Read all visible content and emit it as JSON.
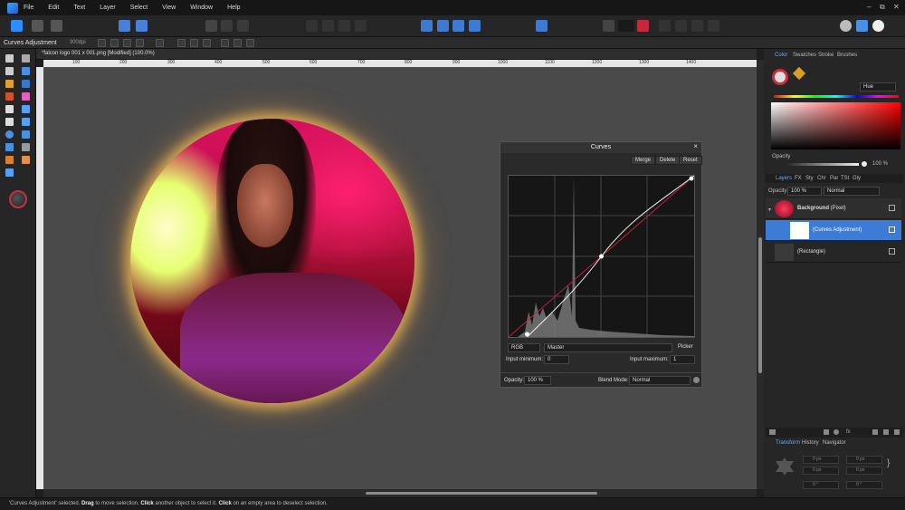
{
  "menu": [
    "File",
    "Edit",
    "Text",
    "Layer",
    "Select",
    "View",
    "Window",
    "Help"
  ],
  "window_controls": [
    "–",
    "⧉",
    "✕"
  ],
  "context": {
    "title": "Curves Adjustment",
    "dpi": "300dpi"
  },
  "document_tab": "*falcon logo 001 x 001.png [Modified] (100.0%)",
  "ruler_ticks": [
    "100",
    "200",
    "300",
    "400",
    "500",
    "600",
    "700",
    "800",
    "900",
    "1000",
    "1100",
    "1200",
    "1300",
    "1400"
  ],
  "curves": {
    "title": "Curves",
    "merge_label": "Merge",
    "delete_label": "Delete",
    "reset_label": "Reset",
    "channel_mode": "RGB",
    "channel": "Master",
    "picker_label": "Picker",
    "input_min_label": "Input minimum:",
    "input_min": "0",
    "input_max_label": "Input maximum:",
    "input_max": "1",
    "opacity_label": "Opacity:",
    "opacity": "100 %",
    "blend_label": "Blend Mode:",
    "blend": "Normal",
    "control_points": [
      [
        0.1,
        0.0
      ],
      [
        0.5,
        0.5
      ],
      [
        1.0,
        1.0
      ]
    ]
  },
  "right_panel": {
    "color_tabs": [
      "Color",
      "Swatches",
      "Stroke",
      "Brushes"
    ],
    "color_mode": "Hue",
    "opacity_label": "Opacity",
    "opacity_value": "100 %",
    "opacity_level": 1.0,
    "layer_tabs": [
      "Layers",
      "FX",
      "Sty",
      "Chr",
      "Par",
      "TSt",
      "Gly"
    ],
    "layers_opacity_label": "Opacity:",
    "layers_opacity": "100 %",
    "layers_blend": "Normal",
    "layers": [
      {
        "name": "Background",
        "suffix": " (Pixel)"
      },
      {
        "name": "(Curves Adjustment)",
        "suffix": ""
      },
      {
        "name": "(Rectangle)",
        "suffix": ""
      }
    ],
    "bottom_tabs": [
      "Transform",
      "History",
      "Navigator"
    ],
    "transform": {
      "x": "0 px",
      "y": "0 px",
      "w": "0 px",
      "h": "0 px",
      "r": "0 °",
      "s": "0 °"
    }
  },
  "status": {
    "prefix": "'Curves Adjustment' selected. ",
    "drag": "Drag",
    "drag_text": " to move selection. ",
    "click": "Click",
    "click_text": " another object to select it. ",
    "click2": "Click",
    "click2_text": " on an empty area to deselect selection."
  },
  "colors": {
    "accent": "#3c7bd6",
    "curve_red": "#c0203a",
    "panel": "#262626"
  }
}
